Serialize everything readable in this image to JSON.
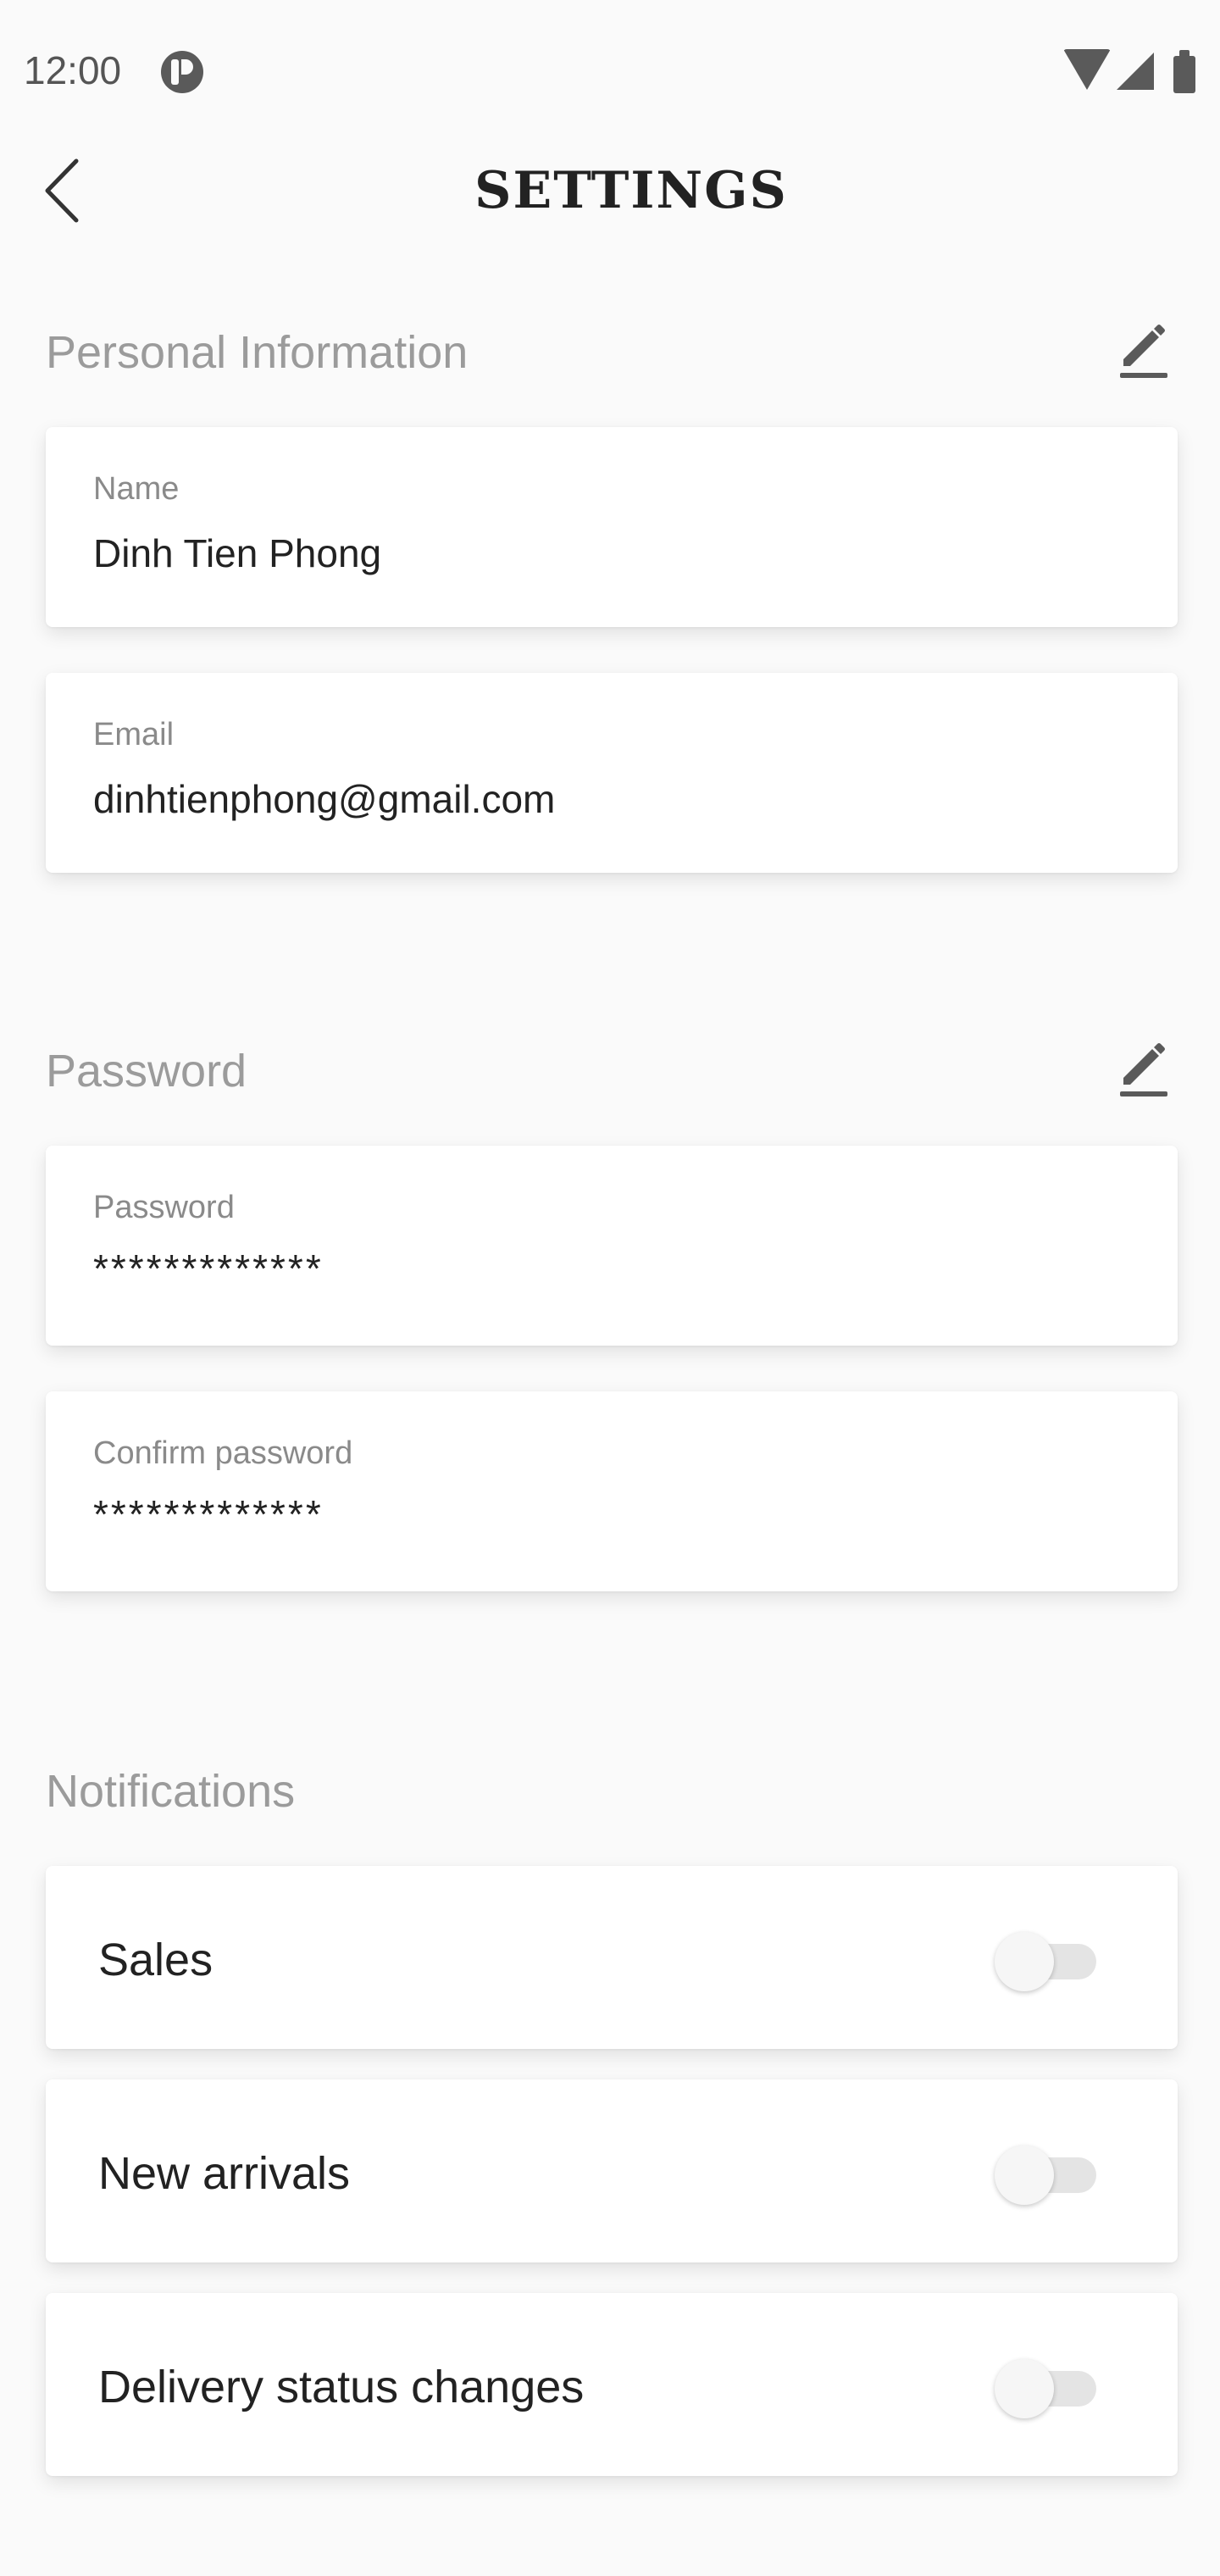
{
  "status_bar": {
    "time": "12:00",
    "icons": [
      "app-notification-icon",
      "wifi-icon",
      "cellular-signal-icon",
      "battery-icon"
    ]
  },
  "header": {
    "title": "SETTINGS",
    "back_icon": "chevron-left-icon"
  },
  "personal_information": {
    "section_title": "Personal Information",
    "edit_icon": "pencil-icon",
    "fields": [
      {
        "label": "Name",
        "value": "Dinh Tien Phong"
      },
      {
        "label": "Email",
        "value": "dinhtienphong@gmail.com"
      }
    ]
  },
  "password": {
    "section_title": "Password",
    "edit_icon": "pencil-icon",
    "fields": [
      {
        "label": "Password",
        "value": "*************"
      },
      {
        "label": "Confirm password",
        "value": "*************"
      }
    ]
  },
  "notifications": {
    "section_title": "Notifications",
    "items": [
      {
        "label": "Sales",
        "enabled": false
      },
      {
        "label": "New arrivals",
        "enabled": false
      },
      {
        "label": "Delivery status changes",
        "enabled": false
      }
    ]
  },
  "colors": {
    "background": "#fafafa",
    "section_title": "#9b9b9b",
    "text": "#222222",
    "icon": "#5a5a5a"
  }
}
